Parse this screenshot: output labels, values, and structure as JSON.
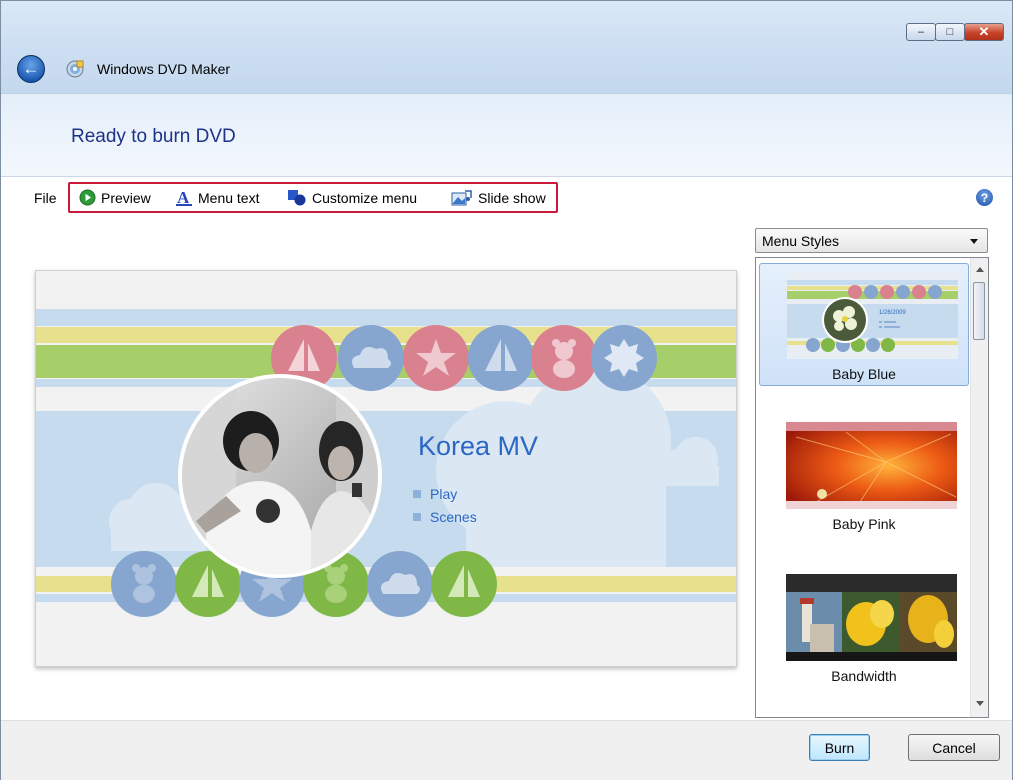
{
  "window": {
    "app_title": "Windows DVD Maker",
    "minimize_glyph": "–",
    "maximize_glyph": "□",
    "close_glyph": "✕"
  },
  "header": {
    "title": "Ready to burn DVD"
  },
  "toolbar": {
    "file": "File",
    "preview": "Preview",
    "menu_text": "Menu text",
    "customize_menu": "Customize menu",
    "slide_show": "Slide show",
    "help": "?"
  },
  "preview": {
    "disc_title": "Korea MV",
    "menu_items": [
      "Play",
      "Scenes"
    ]
  },
  "menu_styles": {
    "dropdown_label": "Menu Styles",
    "items": [
      {
        "label": "Baby Blue",
        "selected": true,
        "thumb_date": "1/26/2009"
      },
      {
        "label": "Baby Pink",
        "selected": false
      },
      {
        "label": "Bandwidth",
        "selected": false
      }
    ]
  },
  "footer": {
    "burn": "Burn",
    "cancel": "Cancel"
  },
  "colors": {
    "heading_blue": "#1e3287",
    "highlight_red": "#c91a3a",
    "stripe_yellow": "#e7e08d",
    "stripe_green": "#a6cf6a",
    "circle_pink": "#d9818f",
    "circle_blue": "#86a6cf",
    "circle_green": "#7fb847"
  }
}
